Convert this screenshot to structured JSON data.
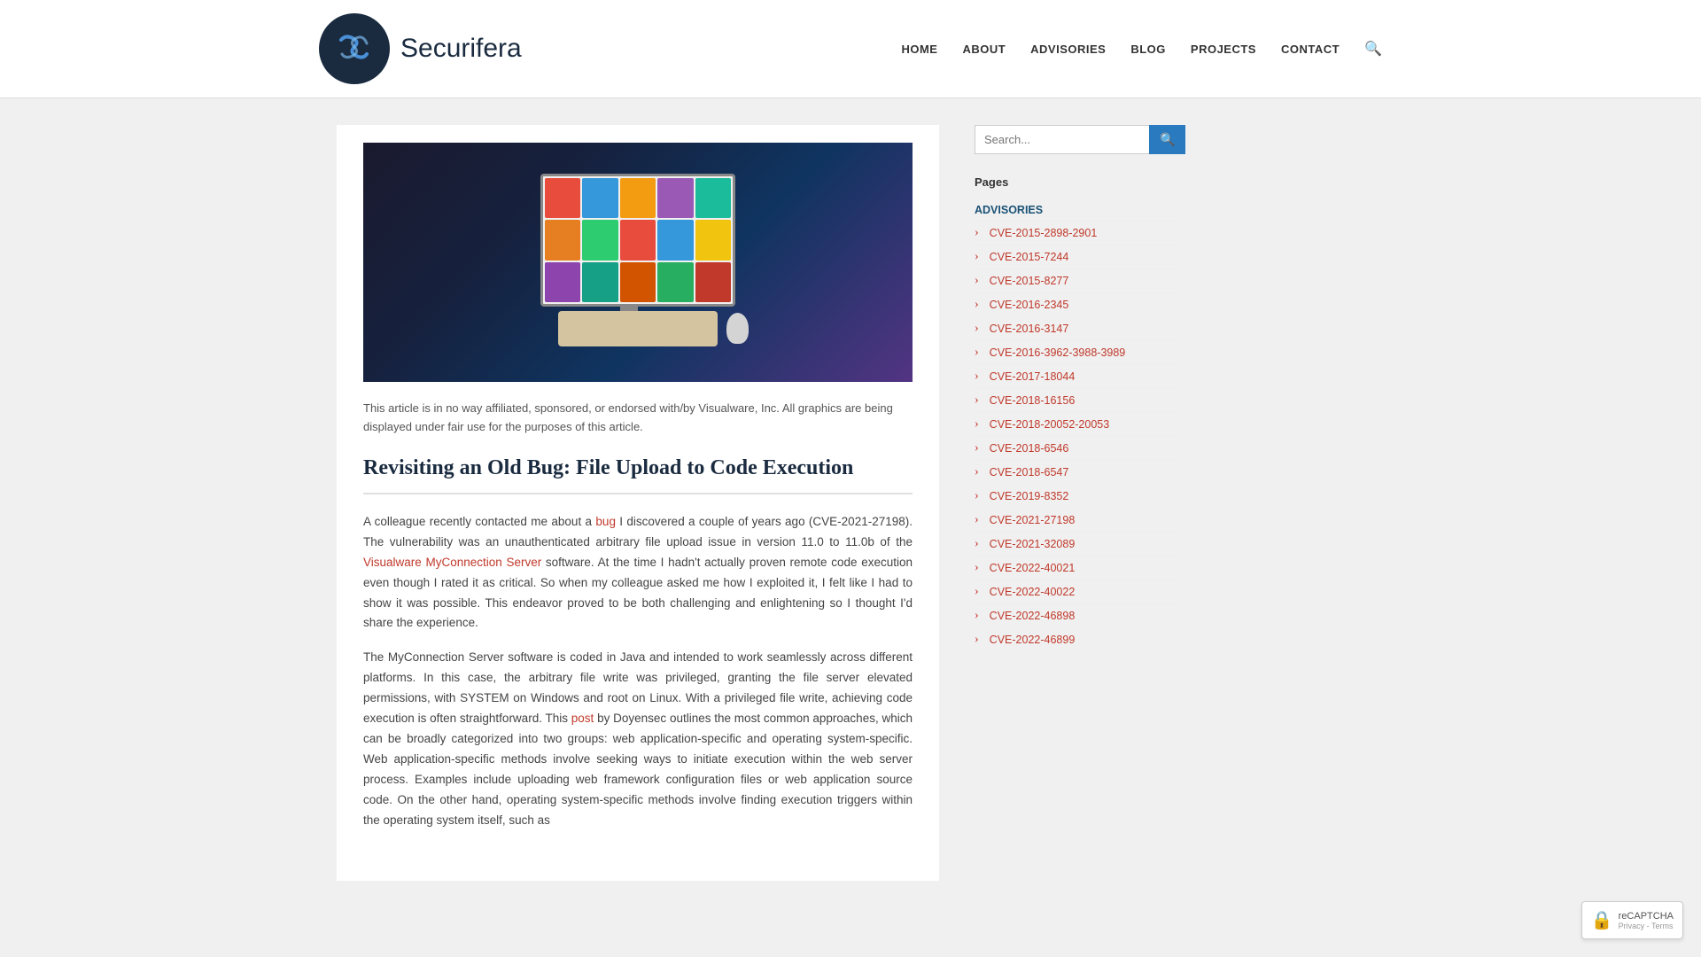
{
  "site": {
    "logo_text_prefix": "Securifera",
    "logo_text_suffix": ""
  },
  "nav": {
    "items": [
      {
        "label": "HOME",
        "href": "#"
      },
      {
        "label": "ABOUT",
        "href": "#"
      },
      {
        "label": "ADVISORIES",
        "href": "#"
      },
      {
        "label": "BLOG",
        "href": "#"
      },
      {
        "label": "PROJECTS",
        "href": "#"
      },
      {
        "label": "CONTACT",
        "href": "#"
      }
    ]
  },
  "search": {
    "placeholder": "Search..."
  },
  "sidebar": {
    "pages_heading": "Pages",
    "pages_list": [
      {
        "label": "ADVISORIES",
        "level": "top"
      },
      {
        "label": "CVE-2015-2898-2901",
        "level": "sub"
      },
      {
        "label": "CVE-2015-7244",
        "level": "sub"
      },
      {
        "label": "CVE-2015-8277",
        "level": "sub"
      },
      {
        "label": "CVE-2016-2345",
        "level": "sub"
      },
      {
        "label": "CVE-2016-3147",
        "level": "sub"
      },
      {
        "label": "CVE-2016-3962-3988-3989",
        "level": "sub"
      },
      {
        "label": "CVE-2017-18044",
        "level": "sub"
      },
      {
        "label": "CVE-2018-16156",
        "level": "sub"
      },
      {
        "label": "CVE-2018-20052-20053",
        "level": "sub"
      },
      {
        "label": "CVE-2018-6546",
        "level": "sub"
      },
      {
        "label": "CVE-2018-6547",
        "level": "sub"
      },
      {
        "label": "CVE-2019-8352",
        "level": "sub"
      },
      {
        "label": "CVE-2021-27198",
        "level": "sub"
      },
      {
        "label": "CVE-2021-32089",
        "level": "sub"
      },
      {
        "label": "CVE-2022-40021",
        "level": "sub"
      },
      {
        "label": "CVE-2022-40022",
        "level": "sub"
      },
      {
        "label": "CVE-2022-46898",
        "level": "sub"
      },
      {
        "label": "CVE-2022-46899",
        "level": "sub"
      }
    ]
  },
  "article": {
    "disclaimer": "This article is in no way affiliated, sponsored, or endorsed with/by Visualware, Inc. All graphics are being displayed under fair use for the purposes of this article.",
    "title": "Revisiting an Old Bug: File Upload to Code Execution",
    "body_p1": "A colleague recently contacted me about a bug I discovered a couple of years ago (CVE-2021-27198). The vulnerability was an unauthenticated arbitrary file upload issue in version 11.0 to 11.0b of the Visualware MyConnection Server software. At the time I hadn't actually proven remote code execution even though I rated it as critical. So when my colleague asked me how I exploited it, I felt like I had to show it was possible. This endeavor proved to be both challenging and enlightening so I thought I'd share the experience.",
    "body_p2": "The MyConnection Server software is coded in Java and intended to work seamlessly across different platforms. In this case, the arbitrary file write was privileged, granting the file server elevated permissions, with SYSTEM on Windows and root on Linux. With a privileged file write, achieving code execution is often straightforward. This post by Doyensec outlines the most common approaches, which can be broadly categorized into two groups: web application-specific and operating system-specific. Web application-specific methods involve seeking ways to initiate execution within the web server process. Examples include uploading web framework configuration files or web application source code. On the other hand, operating system-specific methods involve finding execution triggers within the operating system itself, such as",
    "link_bug": "bug",
    "link_visualware": "Visualware MyConnection Server",
    "link_post": "post"
  }
}
